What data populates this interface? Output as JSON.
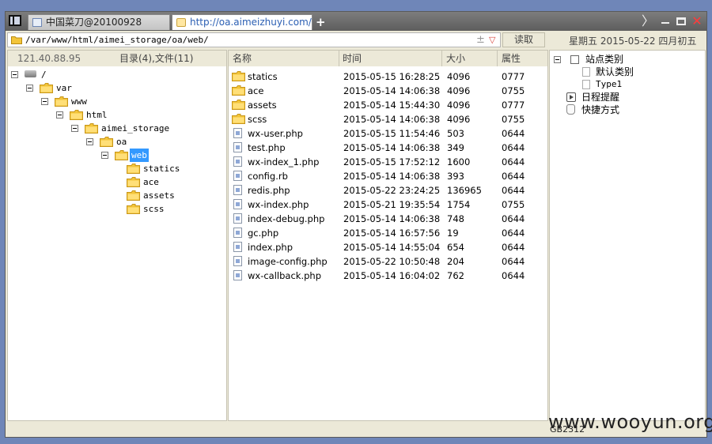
{
  "tabs": [
    {
      "label": "中国菜刀@20100928"
    },
    {
      "label": "http://oa.aimeizhuyi.com/redi..."
    }
  ],
  "new_tab_label": "+",
  "window_controls": {
    "chevron": "〉",
    "close": "✕"
  },
  "toolbar": {
    "path": "/var/www/html/aimei_storage/oa/web/",
    "plus": "±",
    "dropdown": "▽",
    "read_button": "读取",
    "date": "星期五  2015-05-22 四月初五"
  },
  "left_panel": {
    "ip": "121.40.88.95",
    "count": "目录(4),文件(11)",
    "tree": [
      {
        "label": "/",
        "expanded": true,
        "icon": "disk-icon"
      },
      {
        "label": "var",
        "expanded": true
      },
      {
        "label": "www",
        "expanded": true
      },
      {
        "label": "html",
        "expanded": true
      },
      {
        "label": "aimei_storage",
        "expanded": true
      },
      {
        "label": "oa",
        "expanded": true
      },
      {
        "label": "web",
        "expanded": true,
        "selected": true
      },
      {
        "label": "statics"
      },
      {
        "label": "ace"
      },
      {
        "label": "assets"
      },
      {
        "label": "scss"
      }
    ]
  },
  "file_list": {
    "headers": {
      "name": "名称",
      "time": "时间",
      "size": "大小",
      "perm": "属性"
    },
    "rows": [
      {
        "name": "statics",
        "time": "2015-05-15 16:28:25",
        "size": "4096",
        "perm": "0777",
        "type": "folder"
      },
      {
        "name": "ace",
        "time": "2015-05-14 14:06:38",
        "size": "4096",
        "perm": "0755",
        "type": "folder"
      },
      {
        "name": "assets",
        "time": "2015-05-14 15:44:30",
        "size": "4096",
        "perm": "0777",
        "type": "folder"
      },
      {
        "name": "scss",
        "time": "2015-05-14 14:06:38",
        "size": "4096",
        "perm": "0755",
        "type": "folder"
      },
      {
        "name": "wx-user.php",
        "time": "2015-05-15 11:54:46",
        "size": "503",
        "perm": "0644",
        "type": "file"
      },
      {
        "name": "test.php",
        "time": "2015-05-14 14:06:38",
        "size": "349",
        "perm": "0644",
        "type": "file"
      },
      {
        "name": "wx-index_1.php",
        "time": "2015-05-15 17:52:12",
        "size": "1600",
        "perm": "0644",
        "type": "file"
      },
      {
        "name": "config.rb",
        "time": "2015-05-14 14:06:38",
        "size": "393",
        "perm": "0644",
        "type": "file"
      },
      {
        "name": "redis.php",
        "time": "2015-05-22 23:24:25",
        "size": "136965",
        "perm": "0644",
        "type": "file"
      },
      {
        "name": "wx-index.php",
        "time": "2015-05-21 19:35:54",
        "size": "1754",
        "perm": "0755",
        "type": "file"
      },
      {
        "name": "index-debug.php",
        "time": "2015-05-14 14:06:38",
        "size": "748",
        "perm": "0644",
        "type": "file"
      },
      {
        "name": "gc.php",
        "time": "2015-05-14 16:57:56",
        "size": "19",
        "perm": "0644",
        "type": "file"
      },
      {
        "name": "index.php",
        "time": "2015-05-14 14:55:04",
        "size": "654",
        "perm": "0644",
        "type": "file"
      },
      {
        "name": "image-config.php",
        "time": "2015-05-22 10:50:48",
        "size": "204",
        "perm": "0644",
        "type": "file"
      },
      {
        "name": "wx-callback.php",
        "time": "2015-05-14 16:04:02",
        "size": "762",
        "perm": "0644",
        "type": "file"
      }
    ]
  },
  "right_panel": {
    "site_category": "站点类别",
    "default_category": "默认类别",
    "type1": "Type1",
    "schedule": "日程提醒",
    "shortcuts": "快捷方式"
  },
  "statusbar": {
    "encoding": "GB2312"
  },
  "watermark": "www.wooyun.org",
  "colors": {
    "folder": "#f3c53a",
    "selection": "#3399ff",
    "close": "#ff3b3b",
    "link": "#2b5fb3"
  }
}
